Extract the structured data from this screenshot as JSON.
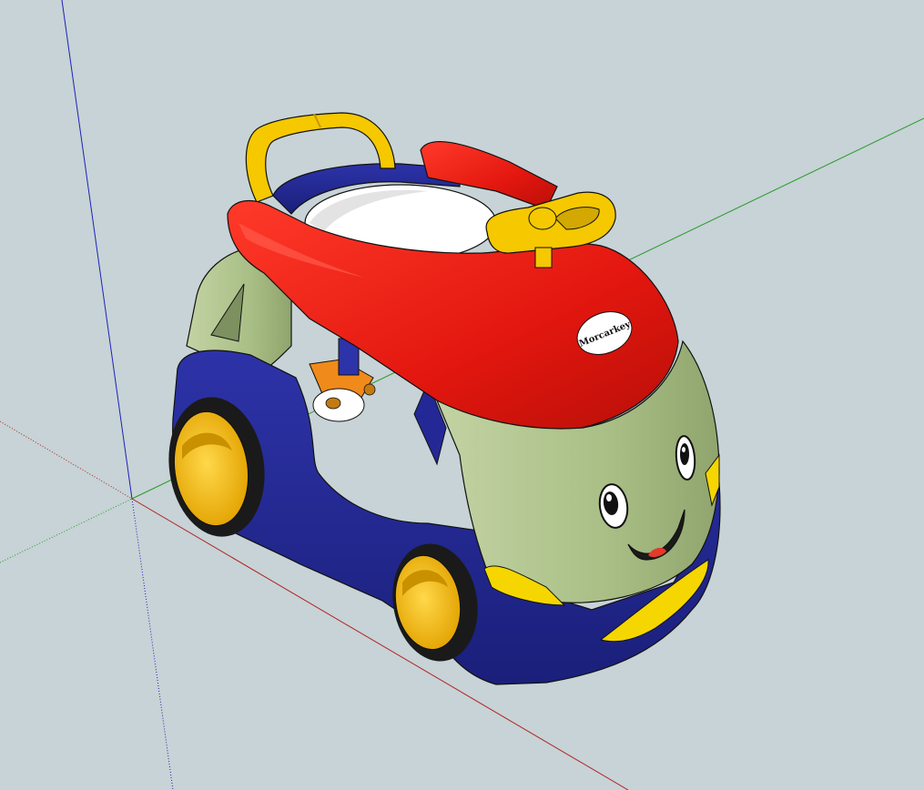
{
  "viewport": {
    "background": "#c7d3d6",
    "axes": {
      "red_axis_color": "#b02020",
      "green_axis_color": "#2a9a2a",
      "blue_axis_color": "#2020b8"
    }
  },
  "model": {
    "subject": "toy-car-walker",
    "colors": {
      "body_blue": "#232896",
      "hood_red": "#e3170f",
      "face_green": "#a9bf86",
      "handle_yellow": "#f5c800",
      "tire_black": "#1a1a1a",
      "rim_yellow": "#f4b400",
      "seat_white": "#ffffff",
      "caster_orange": "#f08a1a"
    },
    "badge_text": "Morcarkey"
  }
}
